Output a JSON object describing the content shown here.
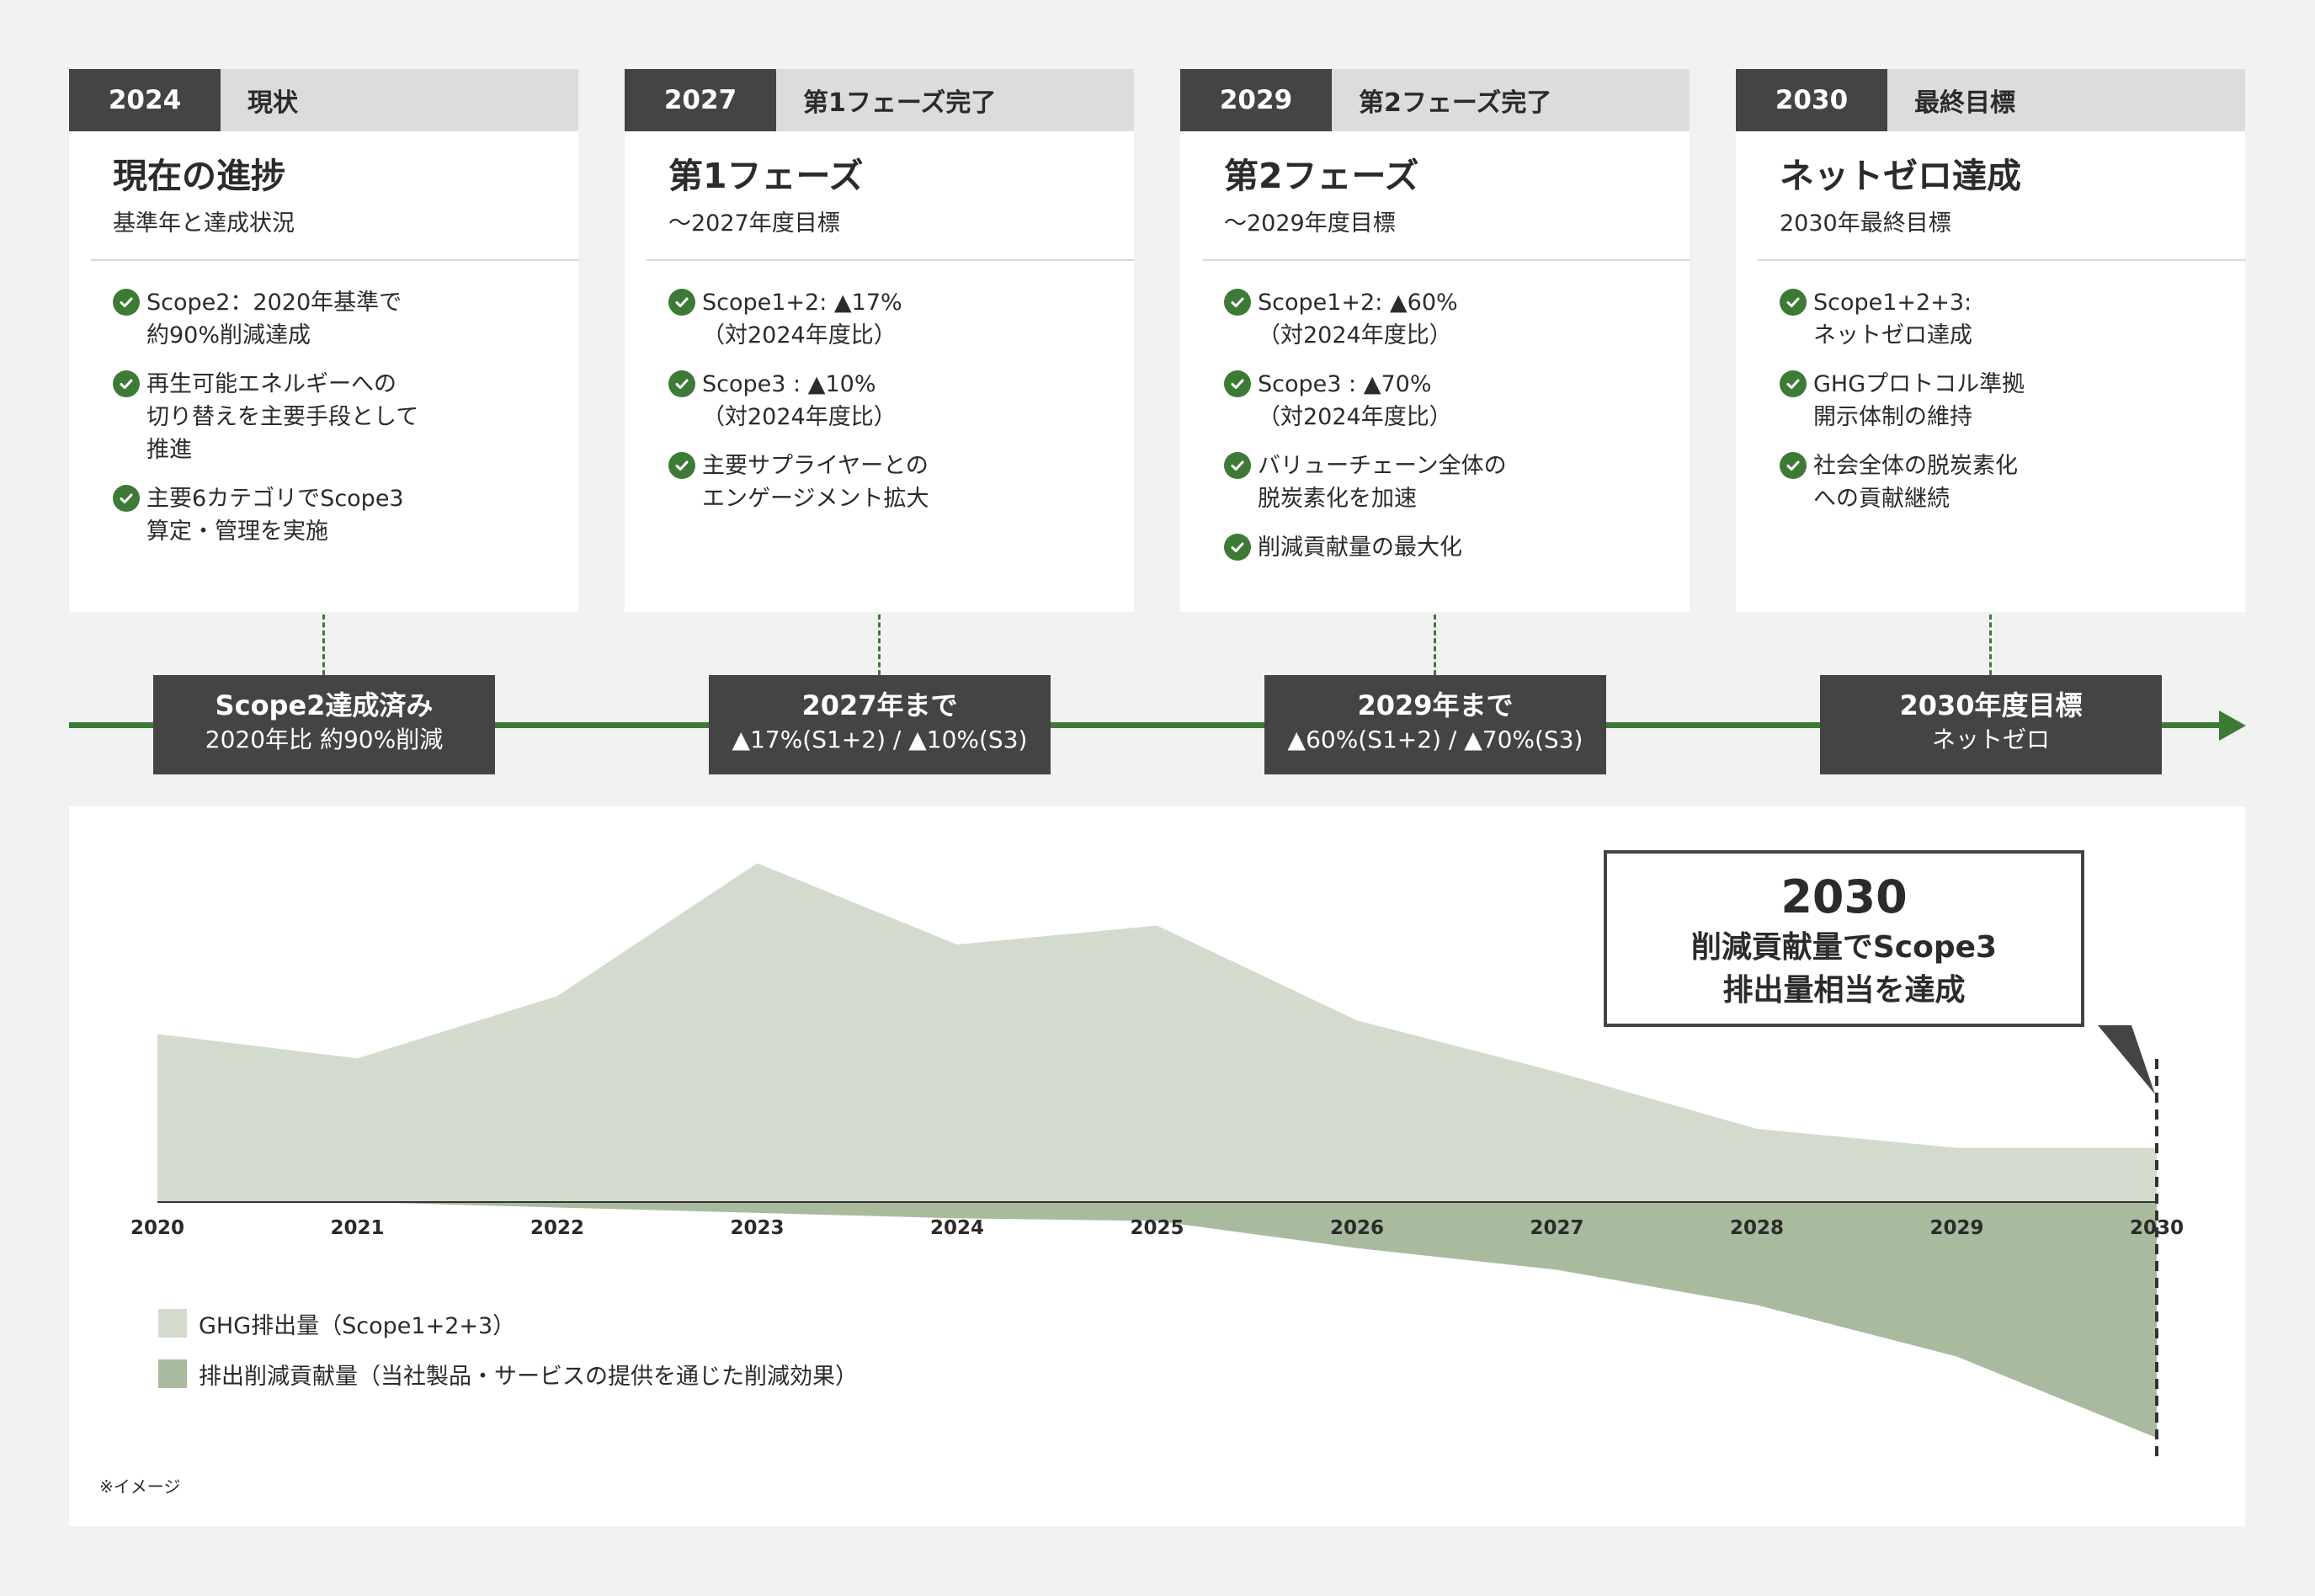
{
  "colors": {
    "accent_green": "#3d7a36",
    "dark_block": "#444444",
    "emissions_area": "#d3dbcd",
    "contribution_area": "#a9bb9e"
  },
  "cards": [
    {
      "year": "2024",
      "status": "現状",
      "title": "現在の進捗",
      "subtitle": "基準年と達成状況",
      "items": [
        "Scope2：2020年基準で\n約90%削減達成",
        "再生可能エネルギーへの\n切り替えを主要手段として\n推進",
        "主要6カテゴリでScope3\n算定・管理を実施"
      ]
    },
    {
      "year": "2027",
      "status": "第1フェーズ完了",
      "title": "第1フェーズ",
      "subtitle": "〜2027年度目標",
      "items": [
        "Scope1+2: ▲17%\n（対2024年度比）",
        "Scope3 : ▲10%\n（対2024年度比）",
        "主要サプライヤーとの\nエンゲージメント拡大"
      ]
    },
    {
      "year": "2029",
      "status": "第2フェーズ完了",
      "title": "第2フェーズ",
      "subtitle": "〜2029年度目標",
      "items": [
        "Scope1+2: ▲60%\n（対2024年度比）",
        "Scope3 : ▲70%\n（対2024年度比）",
        "バリューチェーン全体の\n脱炭素化を加速",
        "削減貢献量の最大化"
      ]
    },
    {
      "year": "2030",
      "status": "最終目標",
      "title": "ネットゼロ達成",
      "subtitle": "2030年最終目標",
      "items": [
        "Scope1+2+3:\nネットゼロ達成",
        "GHGプロトコル準拠\n開示体制の維持",
        "社会全体の脱炭素化\nへの貢献継続"
      ]
    }
  ],
  "milestones": [
    {
      "title": "Scope2達成済み",
      "sub": "2020年比 約90%削減"
    },
    {
      "title": "2027年まで",
      "sub": "▲17%(S1+2) / ▲10%(S3)"
    },
    {
      "title": "2029年まで",
      "sub": "▲60%(S1+2) / ▲70%(S3)"
    },
    {
      "title": "2030年度目標",
      "sub": "ネットゼロ"
    }
  ],
  "callout": {
    "year": "2030",
    "text": "削減貢献量でScope3\n排出量相当を達成"
  },
  "note": "※イメージ",
  "chart_data": {
    "type": "area",
    "x": [
      "2020",
      "2021",
      "2022",
      "2023",
      "2024",
      "2025",
      "2026",
      "2027",
      "2028",
      "2029",
      "2030"
    ],
    "ylim": [
      -100,
      140
    ],
    "series": [
      {
        "name": "GHG排出量（Scope1+2+3）",
        "values": [
          62,
          53,
          76,
          125,
          95,
          102,
          67,
          48,
          27,
          20,
          20
        ]
      },
      {
        "name": "排出削減貢献量（当社製品・サービスの提供を通じた削減効果）",
        "values": [
          0,
          0,
          -2,
          -4,
          -6,
          -7,
          -17,
          -25,
          -38,
          -57,
          -87
        ]
      }
    ],
    "grid": false,
    "legend": "bottom-left"
  }
}
